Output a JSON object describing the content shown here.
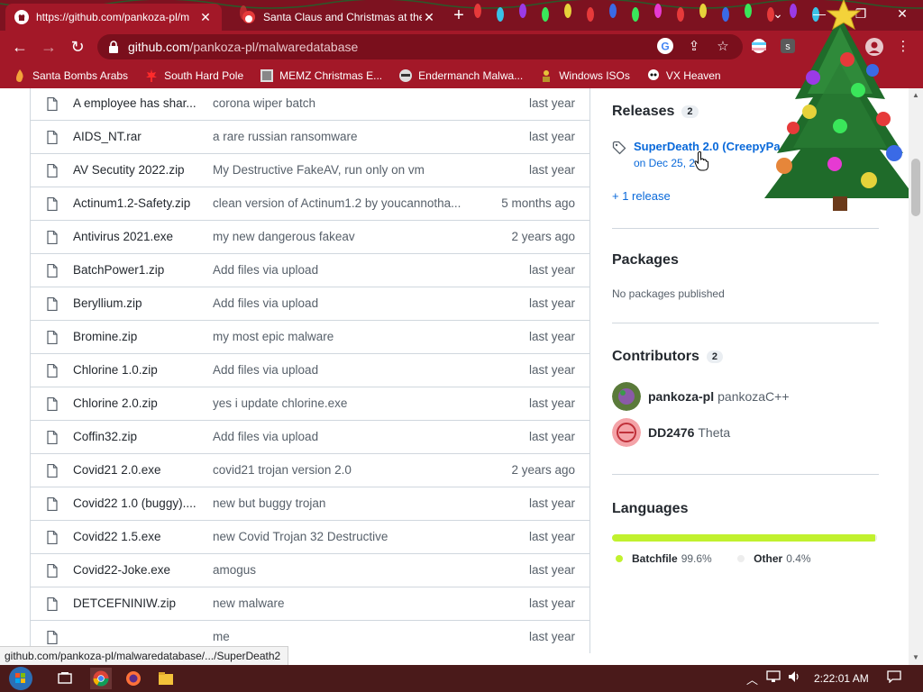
{
  "browser": {
    "tabs": [
      {
        "title": "https://github.com/pankoza-pl/m",
        "active": true
      },
      {
        "title": "Santa Claus and Christmas at the",
        "active": false
      }
    ],
    "url_host": "github.com",
    "url_path": "/pankoza-pl/malwaredatabase",
    "window_controls": {
      "minimize": "—",
      "restore": "❐",
      "close": "✕"
    }
  },
  "bookmarks": [
    {
      "label": "Santa Bombs Arabs",
      "icon": "flame-icon"
    },
    {
      "label": "South Hard Pole",
      "icon": "maple-leaf-icon"
    },
    {
      "label": "MEMZ Christmas E...",
      "icon": "image-icon"
    },
    {
      "label": "Endermanch Malwa...",
      "icon": "raccoon-icon"
    },
    {
      "label": "Windows ISOs",
      "icon": "person-icon"
    },
    {
      "label": "VX Heaven",
      "icon": "skull-icon"
    }
  ],
  "files": [
    {
      "name": "A employee has shar...",
      "message": "corona wiper batch",
      "date": "last year"
    },
    {
      "name": "AIDS_NT.rar",
      "message": "a rare russian ransomware",
      "date": "last year"
    },
    {
      "name": "AV Secutity 2022.zip",
      "message": "My Destructive FakeAV, run only on vm",
      "date": "last year"
    },
    {
      "name": "Actinum1.2-Safety.zip",
      "message": "clean version of Actinum1.2 by youcannotha...",
      "date": "5 months ago"
    },
    {
      "name": "Antivirus 2021.exe",
      "message": "my new dangerous fakeav",
      "date": "2 years ago"
    },
    {
      "name": "BatchPower1.zip",
      "message": "Add files via upload",
      "date": "last year"
    },
    {
      "name": "Beryllium.zip",
      "message": "Add files via upload",
      "date": "last year"
    },
    {
      "name": "Bromine.zip",
      "message": "my most epic malware",
      "date": "last year"
    },
    {
      "name": "Chlorine 1.0.zip",
      "message": "Add files via upload",
      "date": "last year"
    },
    {
      "name": "Chlorine 2.0.zip",
      "message": "yes i update chlorine.exe",
      "date": "last year"
    },
    {
      "name": "Coffin32.zip",
      "message": "Add files via upload",
      "date": "last year"
    },
    {
      "name": "Covid21 2.0.exe",
      "message": "covid21 trojan version 2.0",
      "date": "2 years ago"
    },
    {
      "name": "Covid22 1.0 (buggy)....",
      "message": "new but buggy trojan",
      "date": "last year"
    },
    {
      "name": "Covid22 1.5.exe",
      "message": "new Covid Trojan 32 Destructive",
      "date": "last year"
    },
    {
      "name": "Covid22-Joke.exe",
      "message": "amogus",
      "date": "last year"
    },
    {
      "name": "DETCEFNINIW.zip",
      "message": "new malware",
      "date": "last year"
    },
    {
      "name": "",
      "message": "me",
      "date": "last year"
    }
  ],
  "sidebar": {
    "releases": {
      "title": "Releases",
      "count": "2",
      "latest_name": "SuperDeath 2.0 (CreepyPa",
      "latest_date": "on Dec 25, 2",
      "more_link": "+ 1 release"
    },
    "packages": {
      "title": "Packages",
      "empty_text": "No packages published"
    },
    "contributors": {
      "title": "Contributors",
      "count": "2",
      "people": [
        {
          "login": "pankoza-pl",
          "name": "pankozaC++"
        },
        {
          "login": "DD2476",
          "name": "Theta"
        }
      ]
    },
    "languages": {
      "title": "Languages",
      "items": [
        {
          "name": "Batchfile",
          "percent": "99.6%",
          "fraction": 0.996,
          "color": "#c1f12e"
        },
        {
          "name": "Other",
          "percent": "0.4%",
          "fraction": 0.004,
          "color": "#ededed"
        }
      ]
    }
  },
  "status_url": "github.com/pankoza-pl/malwaredatabase/.../SuperDeath2",
  "taskbar": {
    "clock": "2:22:01 AM"
  }
}
